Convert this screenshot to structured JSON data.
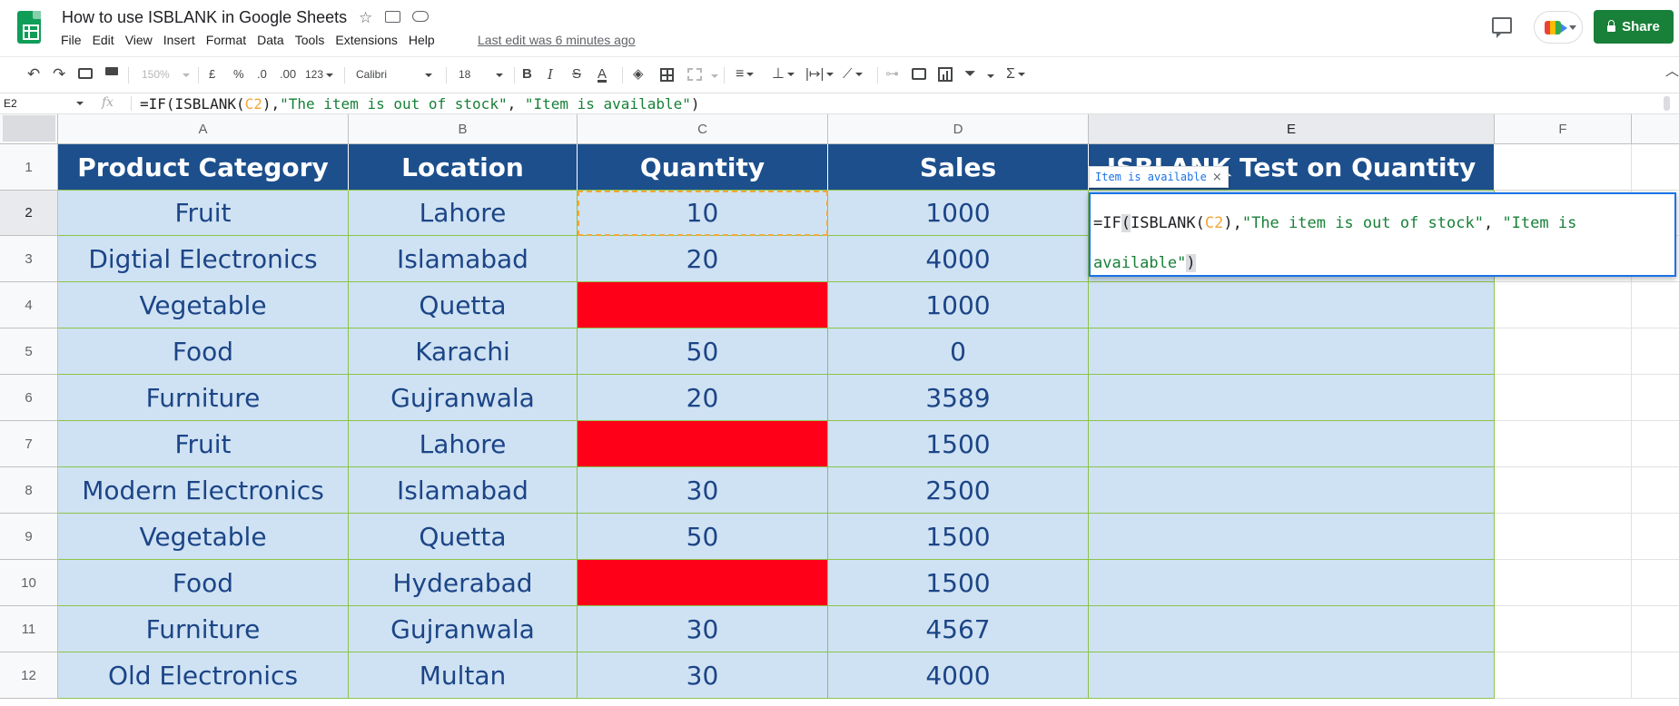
{
  "app": {
    "title": "How to use ISBLANK in Google Sheets",
    "last_edit": "Last edit was 6 minutes ago",
    "share_label": "Share",
    "menu": [
      "File",
      "Edit",
      "View",
      "Insert",
      "Format",
      "Data",
      "Tools",
      "Extensions",
      "Help"
    ]
  },
  "toolbar": {
    "zoom": "150%",
    "currency": "£",
    "percent": "%",
    "decrease_decimal": ".0",
    "increase_decimal": ".00",
    "more_formats": "123",
    "font": "Calibri",
    "font_size": "18",
    "bold": "B",
    "italic": "I",
    "strikethrough": "S",
    "text_color": "A",
    "functions": "Σ"
  },
  "formula_bar": {
    "name_box": "E2",
    "fx": "fx",
    "parts": [
      "=IF(ISBLANK(",
      "C2",
      "),",
      "\"The item is out of stock\"",
      ", ",
      "\"Item is available\"",
      ")"
    ]
  },
  "editor": {
    "tooltip": "Item is available",
    "tooltip_close": "×",
    "parts": [
      "=IF",
      "(",
      "ISBLANK",
      "(",
      "C2",
      "),",
      "\"The item is out of stock\"",
      ", ",
      "\"Item is",
      "available\"",
      ")"
    ]
  },
  "sheet": {
    "columns": [
      "A",
      "B",
      "C",
      "D",
      "E",
      "F"
    ],
    "active_column": "E",
    "active_row": "2",
    "header": [
      "Product Category",
      "Location",
      "Quantity",
      "Sales",
      "ISBLANK Test on Quantity"
    ],
    "rows": [
      {
        "num": "1"
      },
      {
        "num": "2",
        "cells": [
          "Fruit",
          "Lahore",
          "10",
          "1000",
          ""
        ]
      },
      {
        "num": "3",
        "cells": [
          "Digtial Electronics",
          "Islamabad",
          "20",
          "4000",
          ""
        ]
      },
      {
        "num": "4",
        "cells": [
          "Vegetable",
          "Quetta",
          "",
          "1000",
          ""
        ]
      },
      {
        "num": "5",
        "cells": [
          "Food",
          "Karachi",
          "50",
          "0",
          ""
        ]
      },
      {
        "num": "6",
        "cells": [
          "Furniture",
          "Gujranwala",
          "20",
          "3589",
          ""
        ]
      },
      {
        "num": "7",
        "cells": [
          "Fruit",
          "Lahore",
          "",
          "1500",
          ""
        ]
      },
      {
        "num": "8",
        "cells": [
          "Modern Electronics",
          "Islamabad",
          "30",
          "2500",
          ""
        ]
      },
      {
        "num": "9",
        "cells": [
          "Vegetable",
          "Quetta",
          "50",
          "1500",
          ""
        ]
      },
      {
        "num": "10",
        "cells": [
          "Food",
          "Hyderabad",
          "",
          "1500",
          ""
        ]
      },
      {
        "num": "11",
        "cells": [
          "Furniture",
          "Gujranwala",
          "30",
          "4567",
          ""
        ]
      },
      {
        "num": "12",
        "cells": [
          "Old Electronics",
          "Multan",
          "30",
          "4000",
          ""
        ]
      }
    ],
    "colors": {
      "header_fill": "#1c4f8c",
      "body_fill": "#cfe2f3",
      "blank_fill": "#ff0019",
      "border": "#8bc34a",
      "text": "#1c4587"
    }
  }
}
